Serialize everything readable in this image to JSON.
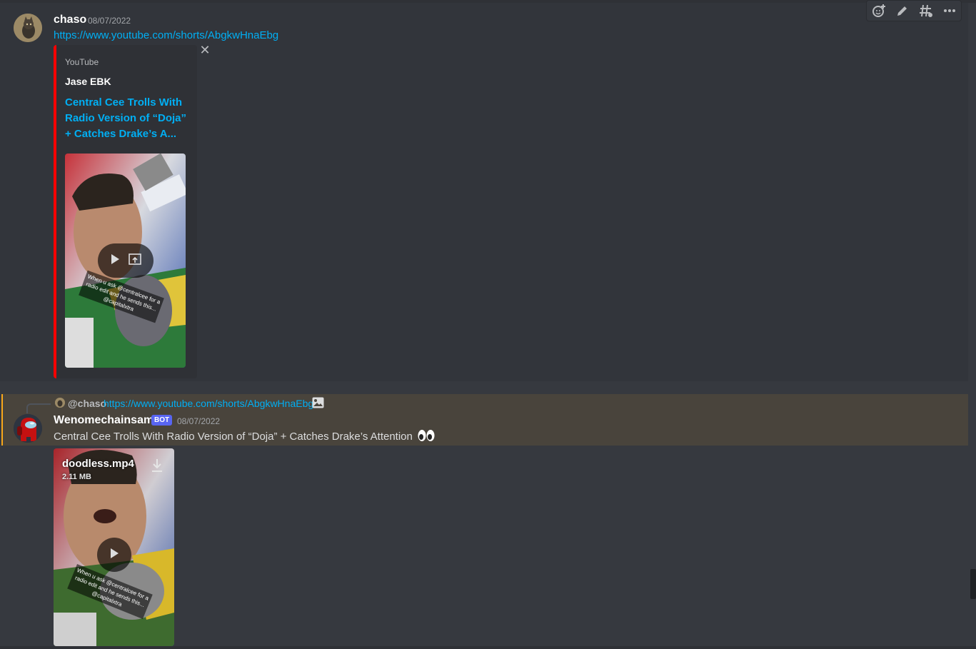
{
  "colors": {
    "background": "#36393f",
    "link": "#00aff4",
    "youtube_red": "#ff0000",
    "mention_bar": "#faa81a",
    "bot_tag": "#5865f2"
  },
  "message1": {
    "username": "chaso",
    "timestamp": "08/07/2022",
    "link": "https://www.youtube.com/shorts/AbgkwHnaEbg",
    "embed": {
      "provider": "YouTube",
      "author": "Jase EBK",
      "title": "Central Cee Trolls With Radio Version of “Doja” + Catches Drake’s A...",
      "thumbnail_caption": [
        "When u ask @centralcee for a",
        "radio edit and he sends this...",
        "@capitalxtra"
      ]
    }
  },
  "message2": {
    "reply": {
      "username": "@chaso",
      "link": "https://www.youtube.com/shorts/AbgkwHnaEbg"
    },
    "username": "Wenomechainsama",
    "bot_tag": "BOT",
    "timestamp": "08/07/2022",
    "content": "Central Cee Trolls With Radio Version of “Doja” + Catches Drake’s Attention",
    "attachment": {
      "filename": "doodless.mp4",
      "size": "2.11 MB",
      "caption": [
        "When u ask @centralcee for a",
        "radio edit and he sends this...",
        "@capitalxtra"
      ]
    }
  },
  "toolbar": {
    "icons": [
      "add-reaction-icon",
      "edit-icon",
      "thread-icon",
      "more-icon"
    ]
  }
}
